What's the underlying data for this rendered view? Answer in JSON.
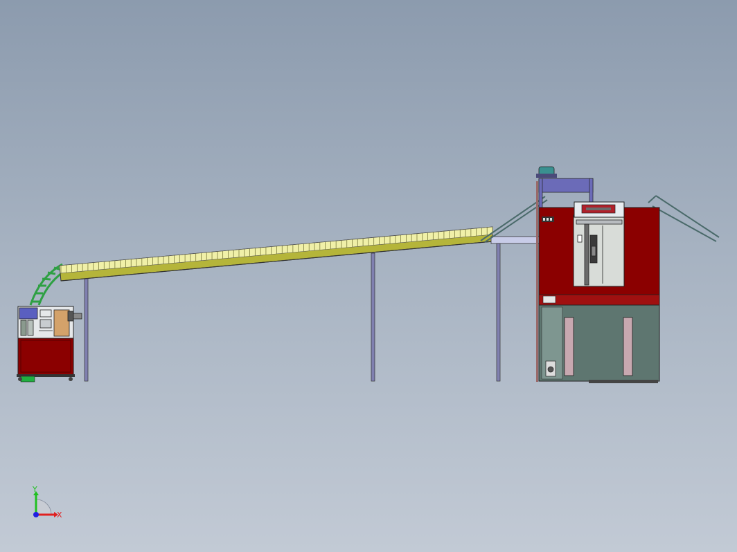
{
  "view": {
    "background_top": "#8c9bae",
    "background_bottom": "#c2cad5"
  },
  "colors": {
    "frame_red": "#8b0000",
    "cabinet_gray": "#5e7670",
    "conveyor_olive": "#b5b53a",
    "conveyor_links": "#f0f0a8",
    "support_purple": "#8080b0",
    "chute_green": "#2ea043",
    "top_frame_blue": "#6b6bb8",
    "motor_teal": "#3a9090",
    "panel_window": "#d8dcd8",
    "wood_panel": "#d4a26a"
  },
  "triad": {
    "x_label": "X",
    "y_label": "Y",
    "x_color": "#e02020",
    "y_color": "#20c020",
    "z_color": "#2020e0"
  },
  "parts": {
    "left_feeder": "left-feeder-machine",
    "incline_conveyor": "incline-conveyor",
    "right_station": "main-processing-station"
  }
}
